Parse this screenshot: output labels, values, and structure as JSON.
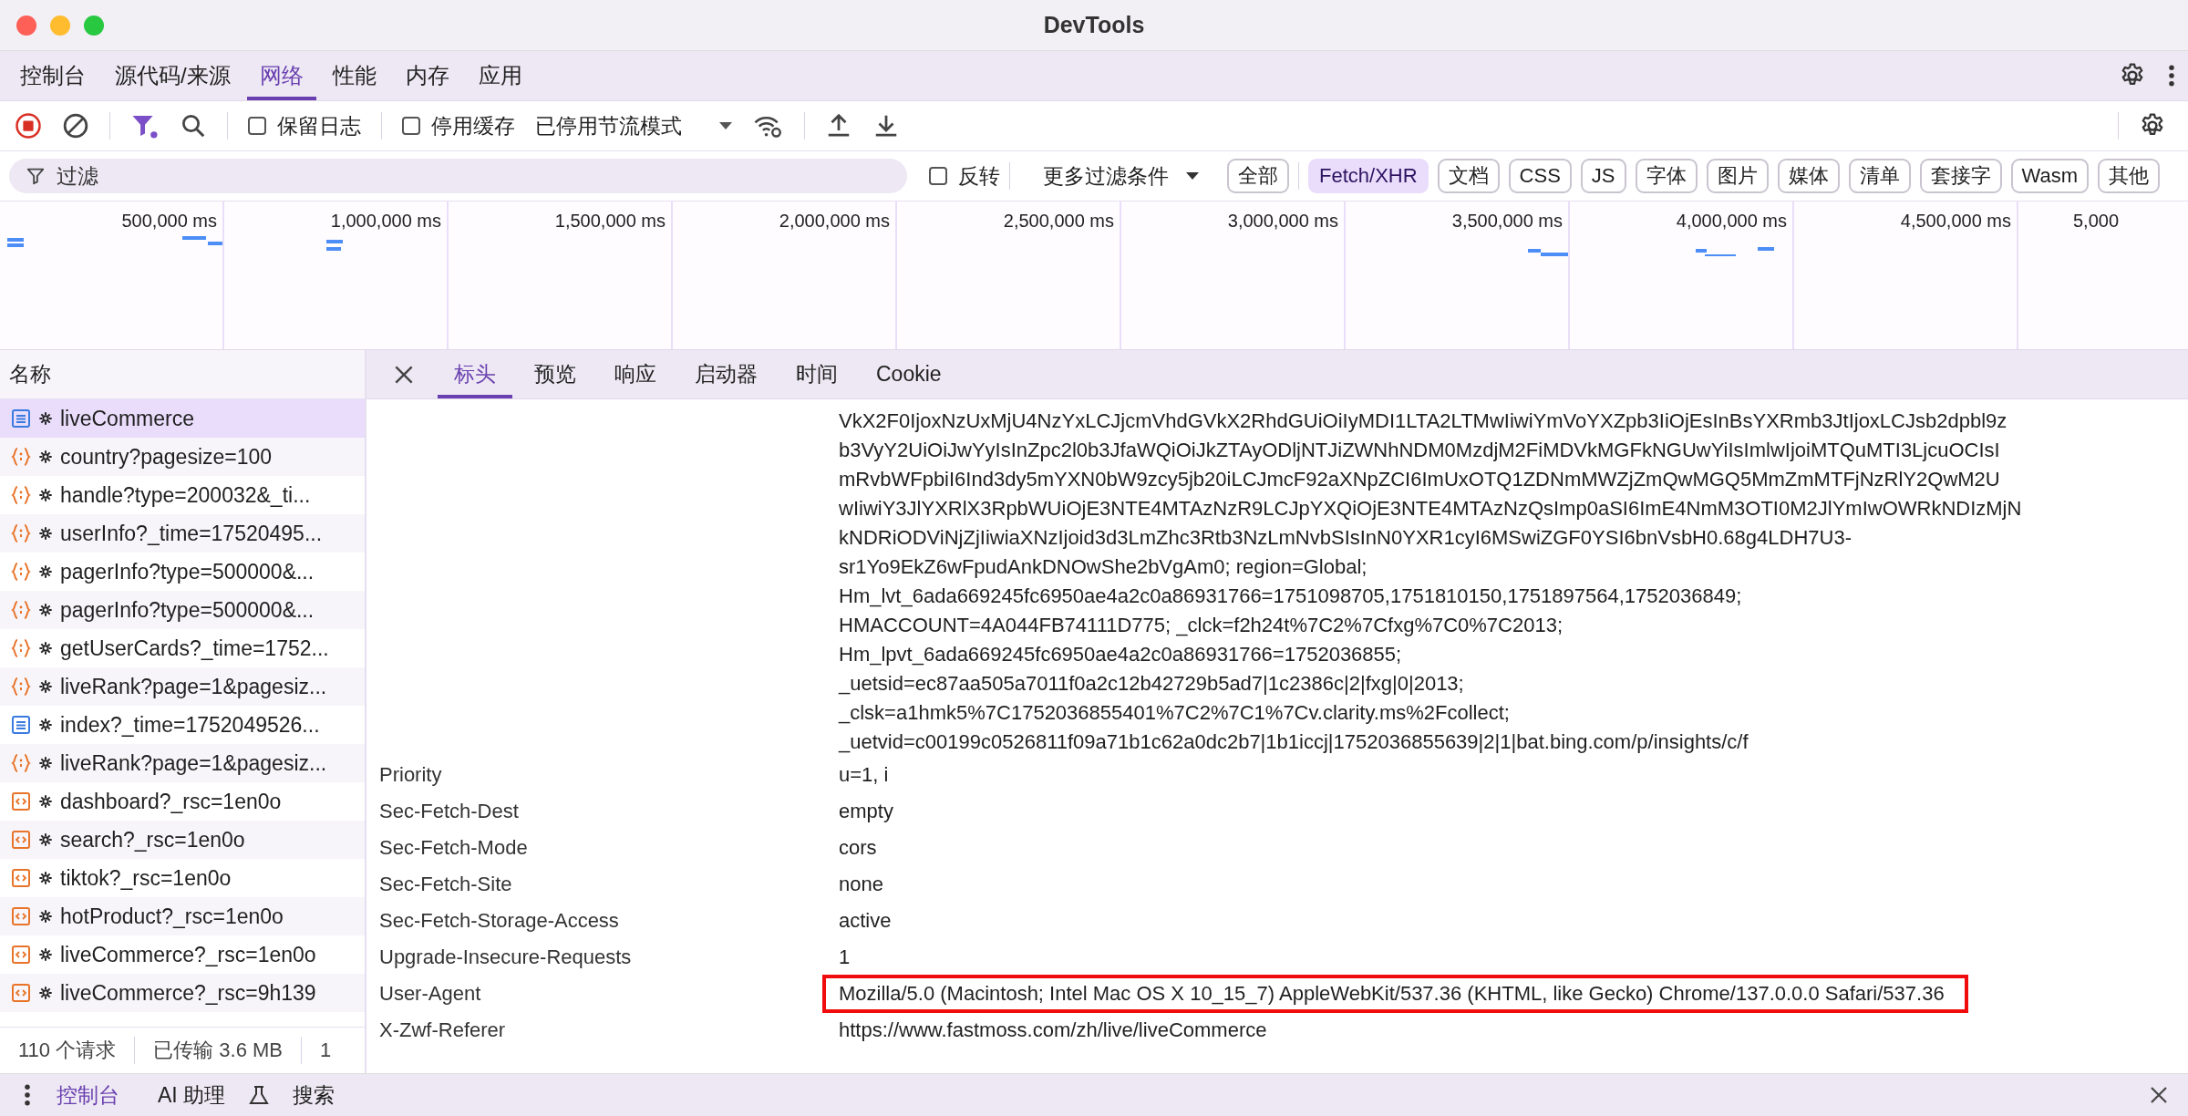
{
  "window": {
    "title": "DevTools"
  },
  "panel_tabs": [
    {
      "label": "控制台",
      "selected": false
    },
    {
      "label": "源代码/来源",
      "selected": false
    },
    {
      "label": "网络",
      "selected": true
    },
    {
      "label": "性能",
      "selected": false
    },
    {
      "label": "内存",
      "selected": false
    },
    {
      "label": "应用",
      "selected": false
    }
  ],
  "toolbar": {
    "preserve_log": {
      "label": "保留日志",
      "checked": false
    },
    "disable_cache": {
      "label": "停用缓存",
      "checked": false
    },
    "throttling": "已停用节流模式"
  },
  "filter": {
    "placeholder": "过滤",
    "invert": {
      "label": "反转",
      "checked": false
    },
    "more_filters": "更多过滤条件",
    "types": [
      {
        "label": "全部",
        "selected": false
      },
      {
        "label": "Fetch/XHR",
        "selected": true
      },
      {
        "label": "文档",
        "selected": false
      },
      {
        "label": "CSS",
        "selected": false
      },
      {
        "label": "JS",
        "selected": false
      },
      {
        "label": "字体",
        "selected": false
      },
      {
        "label": "图片",
        "selected": false
      },
      {
        "label": "媒体",
        "selected": false
      },
      {
        "label": "清单",
        "selected": false
      },
      {
        "label": "套接字",
        "selected": false
      },
      {
        "label": "Wasm",
        "selected": false
      },
      {
        "label": "其他",
        "selected": false
      }
    ]
  },
  "overview": {
    "ticks": [
      "500,000 ms",
      "1,000,000 ms",
      "1,500,000 ms",
      "2,000,000 ms",
      "2,500,000 ms",
      "3,000,000 ms",
      "3,500,000 ms",
      "4,000,000 ms",
      "4,500,000 ms",
      "5,000"
    ]
  },
  "requests": {
    "column": "名称",
    "rows": [
      {
        "name": "liveCommerce",
        "kind": "document",
        "selected": true
      },
      {
        "name": "country?pagesize=100",
        "kind": "fetch",
        "selected": false
      },
      {
        "name": "handle?type=200032&_ti...",
        "kind": "fetch",
        "selected": false
      },
      {
        "name": "userInfo?_time=17520495...",
        "kind": "fetch",
        "selected": false
      },
      {
        "name": "pagerInfo?type=500000&...",
        "kind": "fetch",
        "selected": false
      },
      {
        "name": "pagerInfo?type=500000&...",
        "kind": "fetch",
        "selected": false
      },
      {
        "name": "getUserCards?_time=1752...",
        "kind": "fetch",
        "selected": false
      },
      {
        "name": "liveRank?page=1&pagesiz...",
        "kind": "fetch",
        "selected": false
      },
      {
        "name": "index?_time=1752049526...",
        "kind": "document",
        "selected": false
      },
      {
        "name": "liveRank?page=1&pagesiz...",
        "kind": "fetch",
        "selected": false
      },
      {
        "name": "dashboard?_rsc=1en0o",
        "kind": "markup",
        "selected": false
      },
      {
        "name": "search?_rsc=1en0o",
        "kind": "markup",
        "selected": false
      },
      {
        "name": "tiktok?_rsc=1en0o",
        "kind": "markup",
        "selected": false
      },
      {
        "name": "hotProduct?_rsc=1en0o",
        "kind": "markup",
        "selected": false
      },
      {
        "name": "liveCommerce?_rsc=1en0o",
        "kind": "markup",
        "selected": false
      },
      {
        "name": "liveCommerce?_rsc=9h139",
        "kind": "markup",
        "selected": false
      }
    ]
  },
  "status_bar": [
    "110 个请求",
    "已传输 3.6 MB",
    "1"
  ],
  "details": {
    "tabs": [
      {
        "label": "标头",
        "selected": true
      },
      {
        "label": "预览",
        "selected": false
      },
      {
        "label": "响应",
        "selected": false
      },
      {
        "label": "启动器",
        "selected": false
      },
      {
        "label": "时间",
        "selected": false
      },
      {
        "label": "Cookie",
        "selected": false
      }
    ],
    "cookie_lines": [
      "VkX2F0IjoxNzUxMjU4NzYxLCJjcmVhdGVkX2RhdGUiOiIyMDI1LTA2LTMwIiwiYmVoYXZpb3IiOjEsInBsYXRmb3JtIjoxLCJsb2dpbl9z",
      "b3VyY2UiOiJwYyIsInZpc2l0b3JfaWQiOiJkZTAyODljNTJiZWNhNDM0MzdjM2FiMDVkMGFkNGUwYiIsImlwIjoiMTQuMTI3LjcuOCIsI",
      "mRvbWFpbiI6Ind3dy5mYXN0bW9zcy5jb20iLCJmcF92aXNpZCI6ImUxOTQ1ZDNmMWZjZmQwMGQ5MmZmMTFjNzRlY2QwM2U",
      "wIiwiY3JlYXRlX3RpbWUiOjE3NTE4MTAzNzR9LCJpYXQiOjE3NTE4MTAzNzQsImp0aSI6ImE4NmM3OTI0M2JlYmIwOWRkNDIzMjN",
      "kNDRiODViNjZjIiwiaXNzIjoid3d3LmZhc3Rtb3NzLmNvbSIsInN0YXR1cyI6MSwiZGF0YSI6bnVsbH0.68g4LDH7U3-",
      "sr1Yo9EkZ6wFpudAnkDNOwShe2bVgAm0; region=Global;",
      "Hm_lvt_6ada669245fc6950ae4a2c0a86931766=1751098705,1751810150,1751897564,1752036849;",
      "HMACCOUNT=4A044FB74111D775; _clck=f2h24t%7C2%7Cfxg%7C0%7C2013;",
      "Hm_lpvt_6ada669245fc6950ae4a2c0a86931766=1752036855;",
      "_uetsid=ec87aa505a7011f0a2c12b42729b5ad7|1c2386c|2|fxg|0|2013;",
      "_clsk=a1hmk5%7C1752036855401%7C2%7C1%7Cv.clarity.ms%2Fcollect;",
      "_uetvid=c00199c0526811f09a71b1c62a0dc2b7|1b1iccj|1752036855639|2|1|bat.bing.com/p/insights/c/f"
    ],
    "headers": [
      {
        "name": "Priority",
        "value": "u=1, i",
        "highlighted": false
      },
      {
        "name": "Sec-Fetch-Dest",
        "value": "empty",
        "highlighted": false
      },
      {
        "name": "Sec-Fetch-Mode",
        "value": "cors",
        "highlighted": false
      },
      {
        "name": "Sec-Fetch-Site",
        "value": "none",
        "highlighted": false
      },
      {
        "name": "Sec-Fetch-Storage-Access",
        "value": "active",
        "highlighted": false
      },
      {
        "name": "Upgrade-Insecure-Requests",
        "value": "1",
        "highlighted": false
      },
      {
        "name": "User-Agent",
        "value": "Mozilla/5.0 (Macintosh; Intel Mac OS X 10_15_7) AppleWebKit/537.36 (KHTML, like Gecko) Chrome/137.0.0.0 Safari/537.36",
        "highlighted": true
      },
      {
        "name": "X-Zwf-Referer",
        "value": "https://www.fastmoss.com/zh/live/liveCommerce",
        "highlighted": false
      }
    ]
  },
  "drawer": {
    "tabs": [
      {
        "label": "控制台",
        "selected": true
      },
      {
        "label": "AI 助理",
        "selected": false
      },
      {
        "label": "搜索",
        "selected": false
      }
    ]
  }
}
